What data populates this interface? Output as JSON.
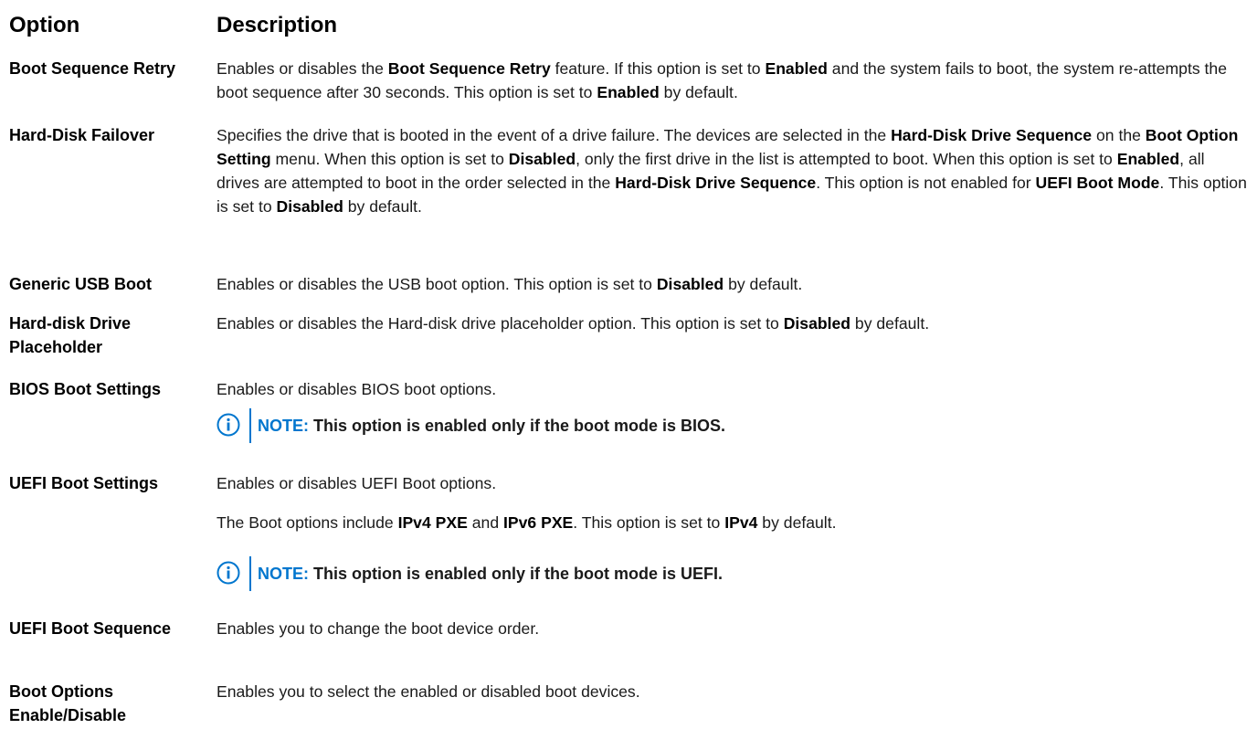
{
  "header": {
    "option": "Option",
    "description": "Description"
  },
  "rows": [
    {
      "option": "Boot Sequence Retry",
      "description": [
        "Enables or disables the ",
        {
          "b": "Boot Sequence Retry"
        },
        " feature. If this option is set to ",
        {
          "b": "Enabled"
        },
        " and the system fails to boot, the system re-attempts the boot sequence after 30 seconds. This option is set to ",
        {
          "b": "Enabled"
        },
        " by default."
      ]
    },
    {
      "option": "Hard-Disk Failover",
      "description": [
        "Specifies the drive that is booted in the event of a drive failure. The devices are selected in the ",
        {
          "b": "Hard-Disk Drive Sequence"
        },
        " on the ",
        {
          "b": "Boot Option Setting"
        },
        " menu. When this option is set to ",
        {
          "b": "Disabled"
        },
        ", only the first drive in the list is attempted to boot. When this option is set to ",
        {
          "b": "Enabled"
        },
        ", all drives are attempted to boot in the order selected in the ",
        {
          "b": "Hard-Disk Drive Sequence"
        },
        ". This option is not enabled for ",
        {
          "b": "UEFI Boot Mode"
        },
        ". This option is set to ",
        {
          "b": "Disabled"
        },
        " by default."
      ]
    },
    {
      "option": "Generic USB Boot",
      "description": [
        "Enables or disables the USB boot option. This option is set to ",
        {
          "b": "Disabled"
        },
        " by default."
      ]
    },
    {
      "option": "Hard-disk Drive Placeholder",
      "description": [
        "Enables or disables the Hard-disk drive placeholder option. This option is set to ",
        {
          "b": "Disabled"
        },
        " by default."
      ]
    },
    {
      "option": "BIOS Boot Settings",
      "description": [
        "Enables or disables BIOS boot options."
      ],
      "note": {
        "label": "NOTE:",
        "text": "This option is enabled only if the boot mode is BIOS."
      }
    },
    {
      "option": "UEFI Boot Settings",
      "description": [
        "Enables or disables UEFI Boot options."
      ],
      "description2": [
        "The Boot options include ",
        {
          "b": "IPv4 PXE"
        },
        " and ",
        {
          "b": "IPv6 PXE"
        },
        ". This option is set to ",
        {
          "b": "IPv4"
        },
        " by default."
      ],
      "note": {
        "label": "NOTE:",
        "text": "This option is enabled only if the boot mode is UEFI."
      }
    },
    {
      "option": "UEFI Boot Sequence",
      "description": [
        "Enables you to change the boot device order."
      ]
    },
    {
      "option": "Boot Options Enable/Disable",
      "description": [
        "Enables you to select the enabled or disabled boot devices."
      ]
    }
  ],
  "icons": {
    "note": "info-circle-icon"
  },
  "colors": {
    "note_accent": "#0076ce",
    "text": "#1a1a1a"
  }
}
